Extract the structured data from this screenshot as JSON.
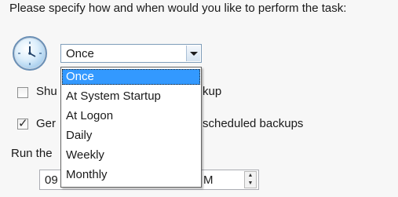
{
  "prompt": "Please specify how and when would you like to perform the task:",
  "icons": {
    "clock": "clock-icon",
    "dropdown_arrow": "chevron-down-icon"
  },
  "schedule": {
    "selected": "Once",
    "options": [
      "Once",
      "At System Startup",
      "At Logon",
      "Daily",
      "Weekly",
      "Monthly"
    ]
  },
  "options": {
    "shutdown": {
      "visible_start": "Shu",
      "visible_end": "kup",
      "checked": false
    },
    "generate": {
      "visible_start": "Ger",
      "visible_end": "scheduled backups",
      "checked": true
    }
  },
  "run": {
    "label_visible": "Run the"
  },
  "time": {
    "visible_start": "09",
    "visible_end": "M"
  },
  "colors": {
    "highlight": "#3399ff",
    "border": "#7f9db9"
  }
}
